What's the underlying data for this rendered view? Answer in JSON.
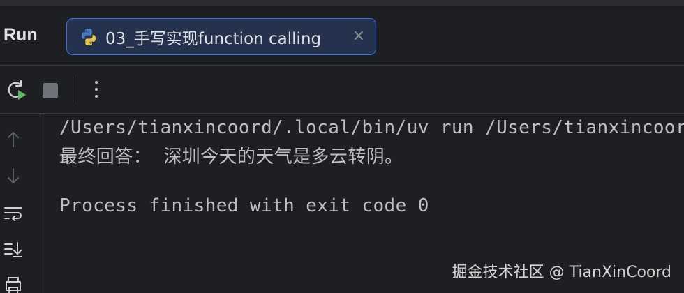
{
  "panel": {
    "title": "Run"
  },
  "tab": {
    "label": "03_手写实现function calling",
    "close_glyph": "×",
    "icon": "python-icon"
  },
  "toolbar": {
    "icons": [
      "rerun-icon",
      "stop-icon",
      "more-options-icon"
    ]
  },
  "gutter": {
    "icons": [
      "scroll-up-icon",
      "scroll-down-icon",
      "soft-wrap-icon",
      "scroll-to-end-icon",
      "print-icon"
    ]
  },
  "console": {
    "lines": [
      "/Users/tianxincoord/.local/bin/uv run /Users/tianxincoord/",
      "最终回答：  深圳今天的天气是多云转阴。",
      "",
      "Process finished with exit code 0"
    ]
  },
  "watermark": "掘金技术社区 @ TianXinCoord",
  "colors": {
    "background": "#1e1f22",
    "tab_bg": "#25324d",
    "tab_border": "#3574f0",
    "text": "#bcbec4",
    "rerun_green": "#5fb865"
  }
}
